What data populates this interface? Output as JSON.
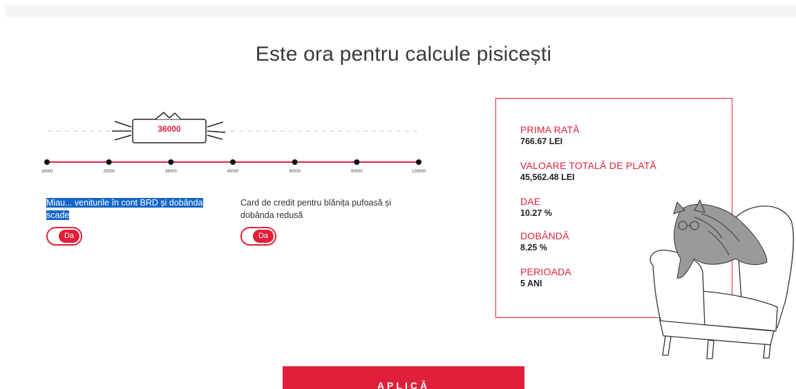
{
  "page": {
    "heading": "Este ora pentru calcule pisicești"
  },
  "slider": {
    "selected_value": "36000",
    "ticks": [
      "16000",
      "25000",
      "36000",
      "45000",
      "60000",
      "90000",
      "120000"
    ]
  },
  "toggles": [
    {
      "label": "Miau... veniturile în cont BRD și dobânda scade",
      "state": "Da"
    },
    {
      "label": "Card de credit pentru blănița pufoasă și dobânda redusă",
      "state": "Da"
    }
  ],
  "results": {
    "items": [
      {
        "label": "PRIMA RATĂ",
        "value": "766.67 LEI"
      },
      {
        "label": "VALOARE TOTALĂ DE PLATĂ",
        "value": "45,562.48 LEI"
      },
      {
        "label": "DAE",
        "value": "10.27 %"
      },
      {
        "label": "DOBÂNDĂ",
        "value": "8.25 %"
      },
      {
        "label": "PERIOADA",
        "value": "5 ANI"
      }
    ]
  },
  "actions": {
    "apply_label": "APLICĂ"
  },
  "colors": {
    "accent": "#e0203a",
    "selection": "#1466c8"
  },
  "icons": {
    "cat": "cat-on-armchair-illustration"
  }
}
